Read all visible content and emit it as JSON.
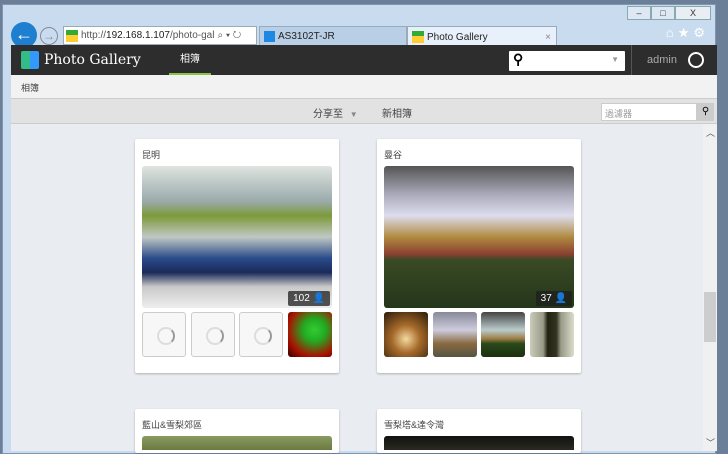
{
  "browser": {
    "url_prefix": "http://",
    "url_host": "192.168.1.107",
    "url_path": "/photo-gal",
    "tabs": [
      {
        "label": "AS3102T-JR"
      },
      {
        "label": "Photo Gallery",
        "close": "×"
      }
    ],
    "window_buttons": [
      "–",
      "□",
      "X"
    ]
  },
  "header": {
    "app_title": "Photo Gallery",
    "nav_albums": "相簿",
    "user": "admin"
  },
  "breadcrumb": "相簿",
  "toolbar": {
    "share_label": "分享至",
    "new_album_label": "新相簿",
    "filter_placeholder": "過濾器"
  },
  "albums": [
    {
      "title": "昆明",
      "count": "102"
    },
    {
      "title": "曼谷",
      "count": "37"
    },
    {
      "title": "藍山&雪梨郊區"
    },
    {
      "title": "雪梨塔&達令灣"
    }
  ]
}
